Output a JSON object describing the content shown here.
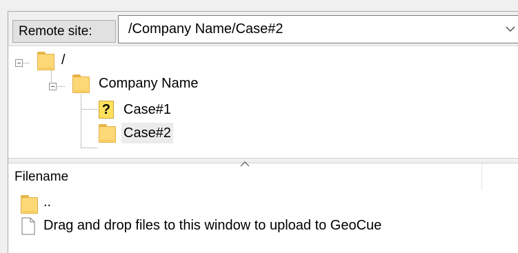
{
  "address_bar": {
    "label": "Remote site:",
    "path": "/Company Name/Case#2"
  },
  "tree": {
    "nodes": [
      {
        "label": "/",
        "icon": "folder-icon",
        "expanded": true
      },
      {
        "label": "Company Name",
        "icon": "folder-icon",
        "expanded": true
      },
      {
        "label": "Case#1",
        "icon": "unknown-folder-icon"
      },
      {
        "label": "Case#2",
        "icon": "folder-icon",
        "selected": true
      }
    ]
  },
  "file_list": {
    "column_header": "Filename",
    "rows": [
      {
        "label": "..",
        "icon": "folder-icon"
      },
      {
        "label": "Drag and drop files to this window to upload to GeoCue",
        "icon": "document-icon"
      }
    ]
  },
  "colors": {
    "folder": "#fcd877",
    "selection": "#ececec",
    "chrome": "#f0f0f0"
  }
}
